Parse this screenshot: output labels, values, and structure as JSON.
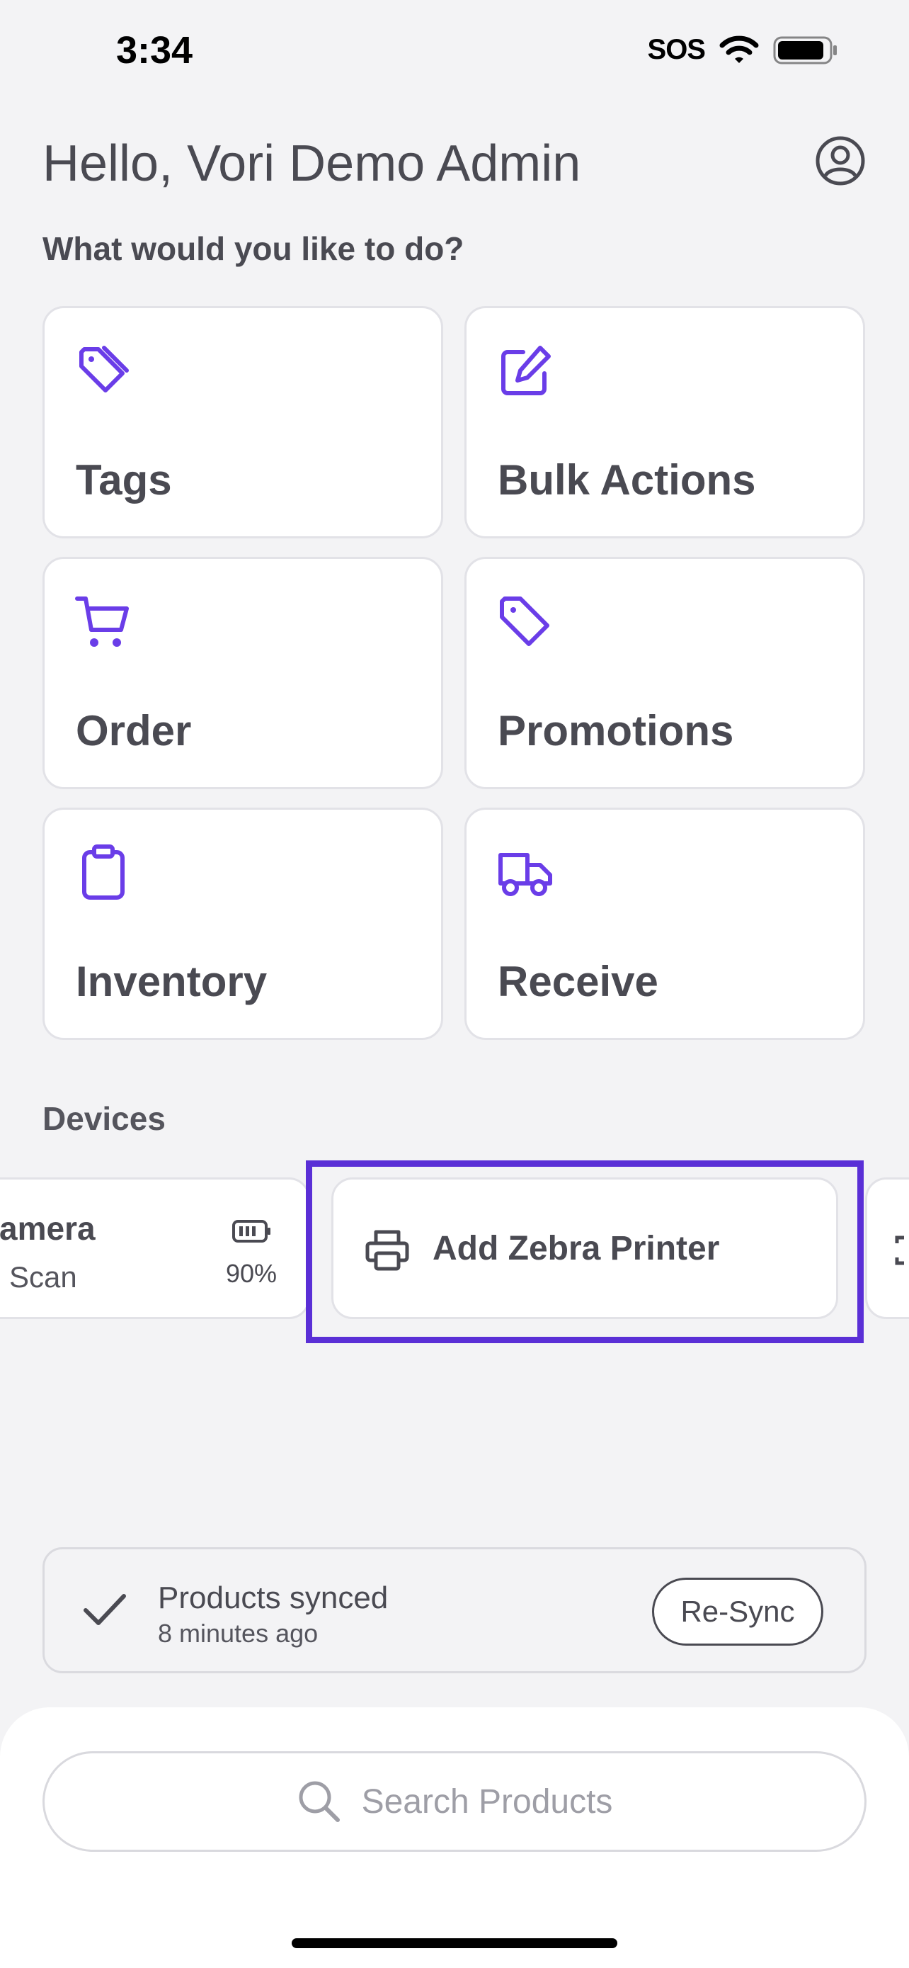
{
  "status_bar": {
    "time": "3:34",
    "sos": "SOS"
  },
  "header": {
    "greeting": "Hello, Vori Demo Admin",
    "prompt": "What would you like to do?"
  },
  "tiles": [
    {
      "label": "Tags",
      "icon": "tags-icon"
    },
    {
      "label": "Bulk Actions",
      "icon": "edit-icon"
    },
    {
      "label": "Order",
      "icon": "cart-icon"
    },
    {
      "label": "Promotions",
      "icon": "tag-icon"
    },
    {
      "label": "Inventory",
      "icon": "clipboard-icon"
    },
    {
      "label": "Receive",
      "icon": "truck-icon"
    }
  ],
  "devices": {
    "heading": "Devices",
    "camera": {
      "title": "amera",
      "subtitle": "Scan",
      "battery": "90%"
    },
    "printer": {
      "label": "Add Zebra Printer",
      "icon": "printer-icon"
    }
  },
  "sync": {
    "title": "Products synced",
    "time": "8 minutes ago",
    "button": "Re-Sync"
  },
  "search": {
    "placeholder": "Search Products"
  },
  "colors": {
    "accent": "#5a2fd6",
    "icon": "#6a3de8",
    "background": "#f3f3f5"
  }
}
